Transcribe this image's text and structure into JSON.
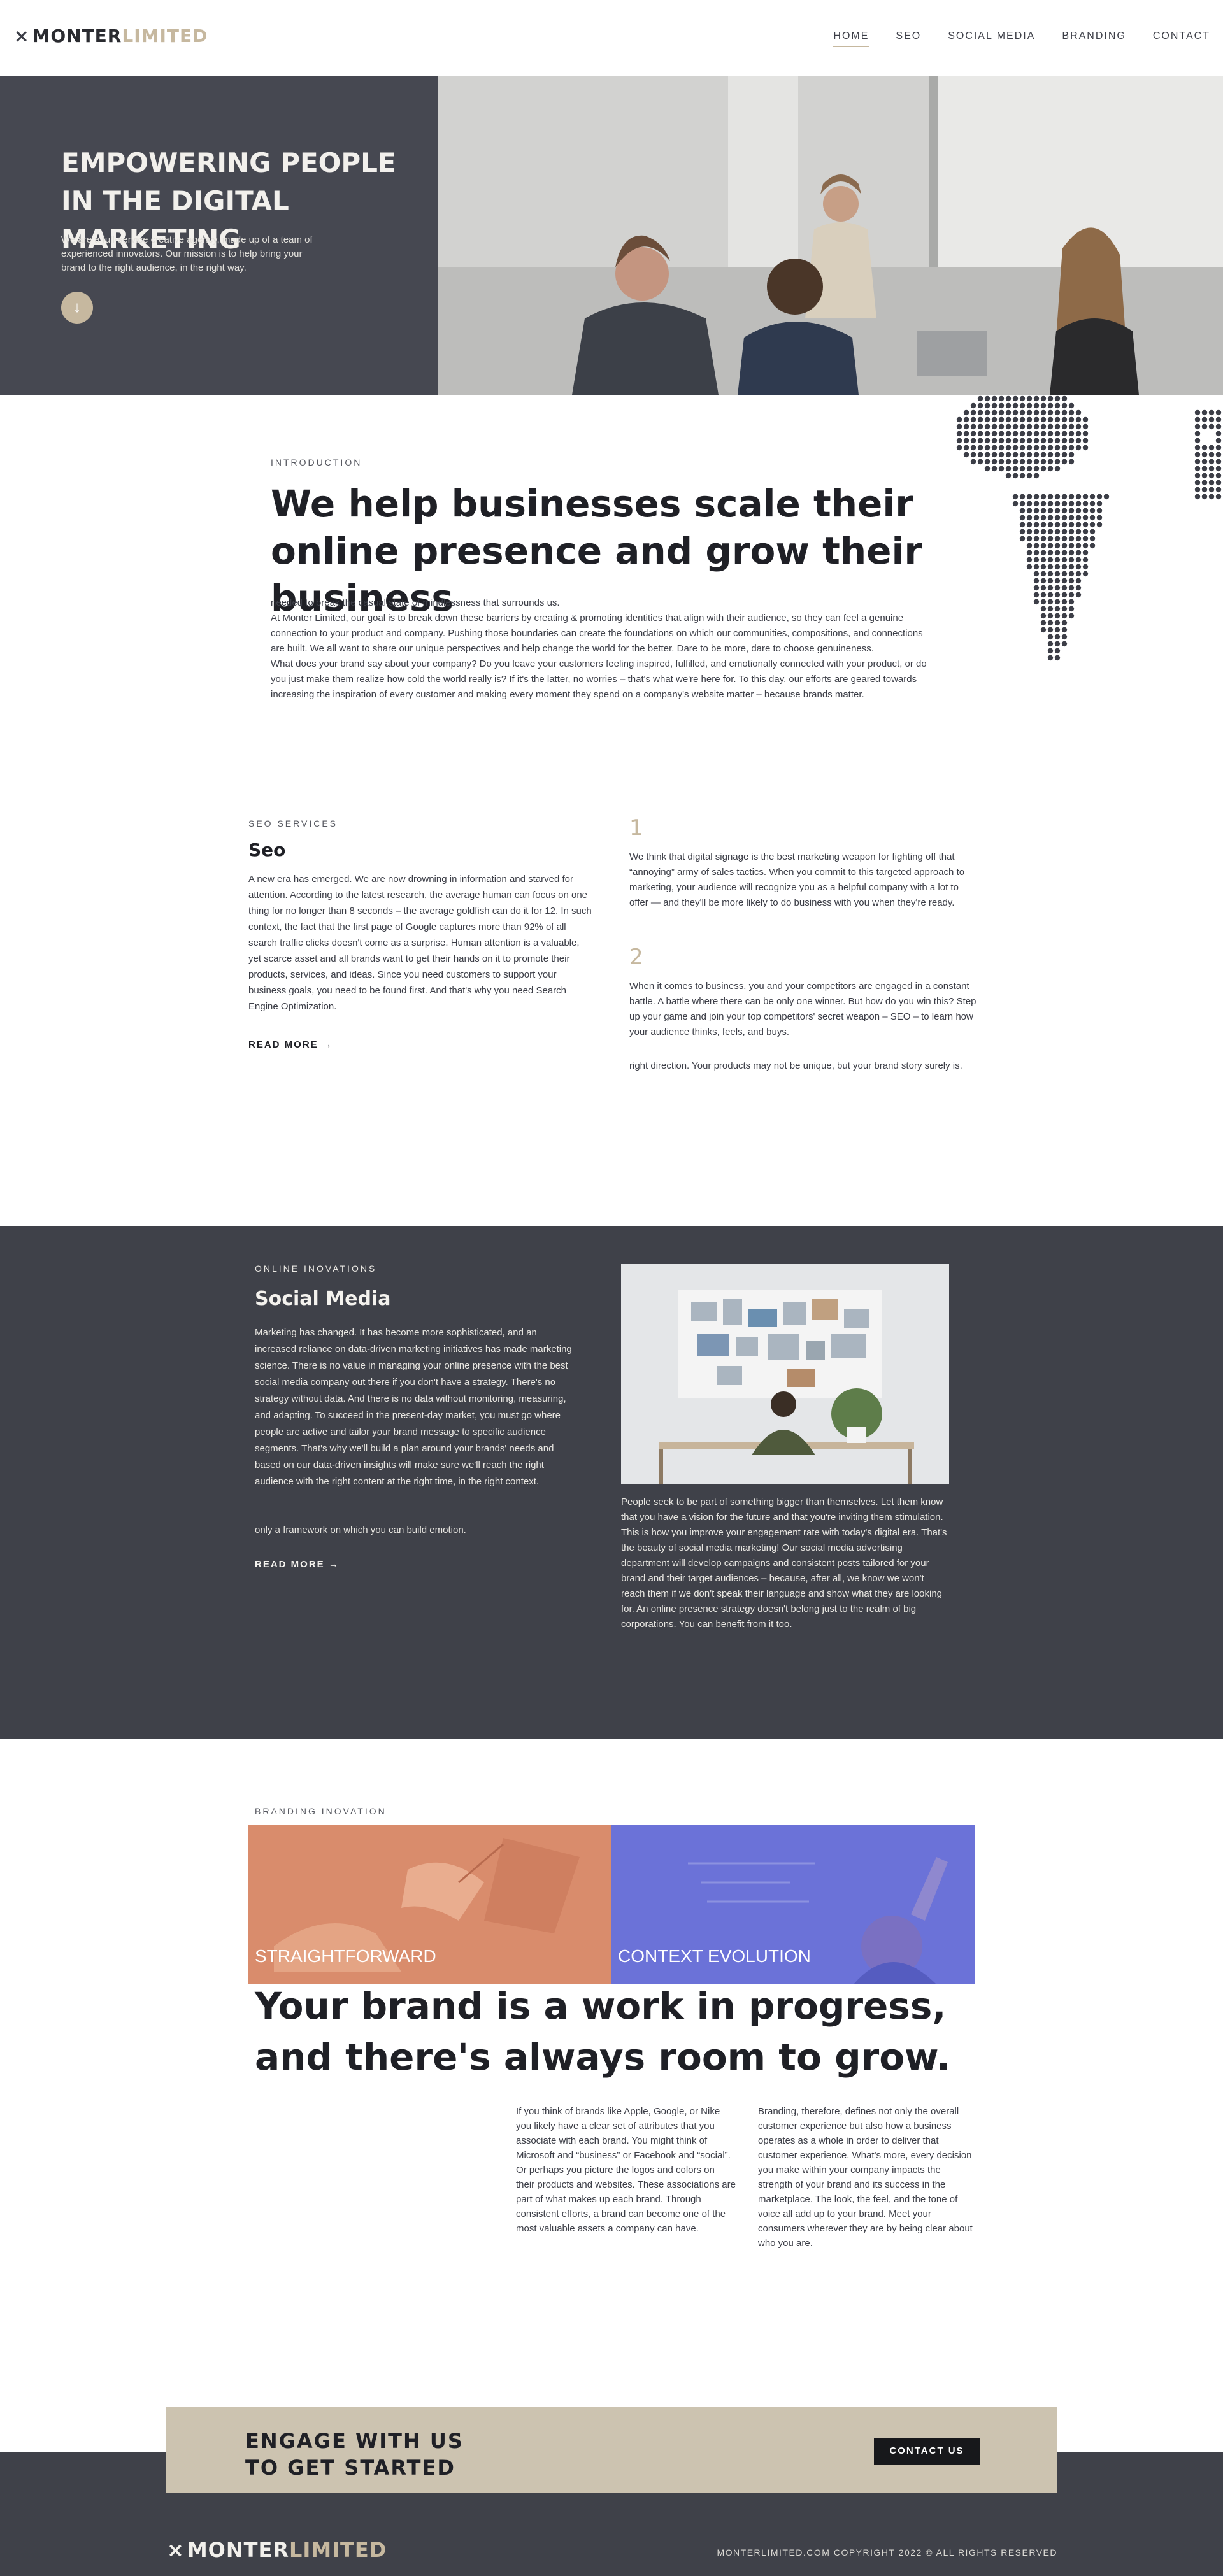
{
  "brand": {
    "mark": "⨯",
    "word1": "MONTER",
    "word2": "LIMITED"
  },
  "nav": [
    {
      "label": "HOME"
    },
    {
      "label": "SEO"
    },
    {
      "label": "SOCIAL MEDIA"
    },
    {
      "label": "BRANDING"
    },
    {
      "label": "CONTACT"
    }
  ],
  "hero": {
    "title": "EMPOWERING PEOPLE IN THE DIGITAL MARKETING",
    "subtitle": "We are a full-service creative agency, made up of a team of experienced innovators. Our mission is to help bring your brand to the right audience, in the right way.",
    "scroll_glyph": "↓"
  },
  "intro": {
    "eyebrow": "INTRODUCTION",
    "heading": "We help businesses scale their online presence and grow their business",
    "paragraphs": [
      "needed to break the casual state of mindlessness that surrounds us.",
      "At Monter Limited, our goal is to break down these barriers by creating & promoting identities that align with their audience, so they can feel a genuine connection to your product and company. Pushing those boundaries can create the foundations on which our communities, compositions, and connections are built. We all want to share our unique perspectives and help change the world for the better. Dare to be more, dare to choose genuineness.",
      "What does your brand say about your company? Do you leave your customers feeling inspired, fulfilled, and emotionally connected with your product, or do you just make them realize how cold the world really is? If it's the latter, no worries – that's what we're here for. To this day, our efforts are geared towards increasing the inspiration of every customer and making every moment they spend on a company's website matter – because brands matter."
    ]
  },
  "seo": {
    "eyebrow": "SEO SERVICES",
    "title": "Seo",
    "body": "A new era has emerged. We are now drowning in information and starved for attention. According to the latest research, the average human can focus on one thing for no longer than 8 seconds – the average goldfish can do it for 12. In such context, the fact that the first page of Google captures more than 92% of all search traffic clicks doesn't come as a surprise. Human attention is a valuable, yet scarce asset and all brands want to get their hands on it to promote their products, services, and ideas. Since you need customers to support your business goals, you need to be found first. And that's why you need Search Engine Optimization.",
    "read_more": "READ MORE →",
    "points": [
      {
        "num": "1",
        "text": "We think that digital signage is the best marketing weapon for fighting off that “annoying” army of sales tactics. When you commit to this targeted approach to marketing, your audience will recognize you as a helpful company with a lot to offer — and they'll be more likely to do business with you when they're ready."
      },
      {
        "num": "2",
        "text": "When it comes to business, you and your competitors are engaged in a constant battle. A battle where there can be only one winner. But how do you win this? Step up your game and join your top competitors' secret weapon – SEO – to learn how your audience thinks, feels, and buys."
      }
    ],
    "tail": "right direction. Your products may not be unique, but your brand story surely is."
  },
  "social": {
    "eyebrow": "ONLINE INOVATIONS",
    "title": "Social Media",
    "body": "Marketing has changed. It has become more sophisticated, and an increased reliance on data-driven marketing initiatives has made marketing science. There is no value in managing your online presence with the best social media company out there if you don't have a strategy. There's no strategy without data. And there is no data without monitoring, measuring, and adapting. To succeed in the present-day market, you must go where people are active and tailor your brand message to specific audience segments. That's why we'll build a plan around your brands' needs and based on our data-driven insights will make sure we'll reach the right audience with the right content at the right time, in the right context.",
    "body2": "only a framework on which you can build emotion.",
    "read_more": "READ MORE →",
    "right_text": "People seek to be part of something bigger than themselves. Let them know that you have a vision for the future and that you're inviting them stimulation. This is how you improve your engagement rate with today's digital era. That's the beauty of social media marketing! Our social media advertising department will develop campaigns and consistent posts tailored for your brand and their target audiences – because, after all, we know we won't reach them if we don't speak their language and show what they are looking for. An online presence strategy doesn't belong just to the realm of big corporations. You can benefit from it too."
  },
  "branding": {
    "eyebrow": "BRANDING INOVATION",
    "card_left": "STRAIGHTFORWARD",
    "card_right": "CONTEXT EVOLUTION",
    "heading": "Your brand is a work in progress, and there's always room to grow.",
    "col1": "If you think of brands like Apple, Google, or Nike you likely have a clear set of attributes that you associate with each brand. You might think of Microsoft and “business” or Facebook and “social”. Or perhaps you picture the logos and colors on their products and websites. These associations are part of what makes up each brand. Through consistent efforts, a brand can become one of the most valuable assets a company can have.",
    "col2": "Branding, therefore, defines not only the overall customer experience but also how a business operates as a whole in order to deliver that customer experience. What's more, every decision you make within your company impacts the strength of your brand and its success in the marketplace. The look, the feel, and the tone of voice all add up to your brand. Meet your consumers wherever they are by being clear about who you are."
  },
  "cta": {
    "line1": "ENGAGE WITH US",
    "line2": "TO GET STARTED",
    "button": "CONTACT US"
  },
  "footer": {
    "copyright": "MONTERLIMITED.COM COPYRIGHT 2022 © ALL RIGHTS RESERVED"
  },
  "colors": {
    "accent": "#c6b89f",
    "dark": "#464851",
    "card_left": "#d98c6c",
    "card_right": "#6b72d8"
  }
}
